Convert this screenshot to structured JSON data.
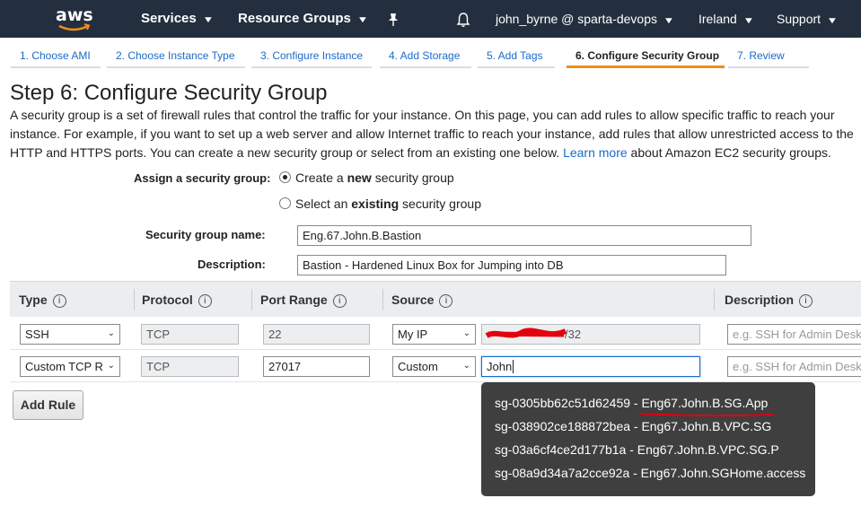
{
  "nav": {
    "logo": "aws",
    "services": "Services",
    "resource_groups": "Resource Groups",
    "account": "john_byrne @ sparta-devops",
    "region": "Ireland",
    "support": "Support"
  },
  "tabs": [
    {
      "label": "1. Choose AMI"
    },
    {
      "label": "2. Choose Instance Type"
    },
    {
      "label": "3. Configure Instance"
    },
    {
      "label": "4. Add Storage"
    },
    {
      "label": "5. Add Tags"
    },
    {
      "label": "6. Configure Security Group",
      "active": true
    },
    {
      "label": "7. Review"
    }
  ],
  "page": {
    "title": "Step 6: Configure Security Group",
    "intro": "A security group is a set of firewall rules that control the traffic for your instance. On this page, you can add rules to allow specific traffic to reach your instance. For example, if you want to set up a web server and allow Internet traffic to reach your instance, add rules that allow unrestricted access to the HTTP and HTTPS ports. You can create a new security group or select from an existing one below.",
    "learn_more": "Learn more",
    "intro_tail": "about Amazon EC2 security groups."
  },
  "assign": {
    "label": "Assign a security group:",
    "create_prefix": "Create a ",
    "create_bold": "new",
    "create_suffix": " security group",
    "select_prefix": "Select an ",
    "select_bold": "existing",
    "select_suffix": " security group",
    "selected": "create"
  },
  "sg_name": {
    "label": "Security group name:",
    "value": "Eng.67.John.B.Bastion"
  },
  "description": {
    "label": "Description:",
    "value": "Bastion - Hardened Linux Box for Jumping into DB"
  },
  "table": {
    "headers": {
      "type": "Type",
      "protocol": "Protocol",
      "port_range": "Port Range",
      "source": "Source",
      "description": "Description"
    },
    "info_glyph": "i",
    "rows": [
      {
        "type": "SSH",
        "protocol": "TCP",
        "port": "22",
        "source": "My IP",
        "cidr_suffix": "/32",
        "desc_placeholder": "e.g. SSH for Admin Desktop"
      },
      {
        "type": "Custom TCP R",
        "protocol": "TCP",
        "port": "27017",
        "source": "Custom",
        "cidr": "John",
        "desc_placeholder": "e.g. SSH for Admin Desktop"
      }
    ]
  },
  "add_rule": "Add Rule",
  "autocomplete": [
    "sg-0305bb62c51d62459 - Eng67.John.B.SG.App",
    "sg-038902ce188872bea - Eng67.John.B.VPC.SG",
    "sg-03a6cf4ce2d177b1a - Eng67.John.B.VPC.SG.P",
    "sg-08a9d34a7a2cce92a - Eng67.John.SGHome.access"
  ],
  "colors": {
    "nav_bg": "#232f3e",
    "accent": "#f08d1a",
    "link": "#1b6ac9",
    "annotation_red": "#e3000f"
  }
}
